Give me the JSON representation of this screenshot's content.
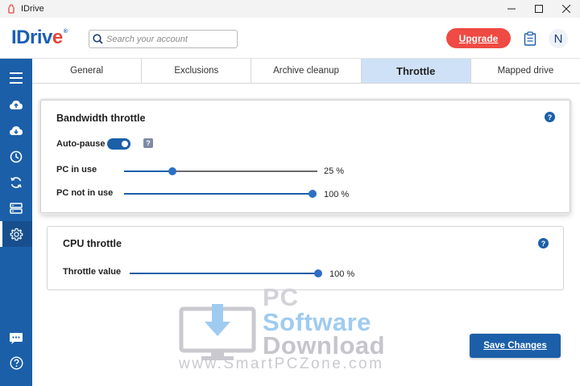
{
  "window": {
    "title": "IDrive",
    "controls": [
      "minimize-icon",
      "maximize-icon",
      "close-icon"
    ]
  },
  "header": {
    "logo_text": "IDriv",
    "logo_accent": "e",
    "search_placeholder": "Search your account",
    "upgrade_label": "Upgrade",
    "avatar_initial": "N"
  },
  "sidebar": {
    "items": [
      {
        "icon": "menu-icon"
      },
      {
        "icon": "cloud-upload-icon"
      },
      {
        "icon": "cloud-download-icon"
      },
      {
        "icon": "history-icon"
      },
      {
        "icon": "sync-icon"
      },
      {
        "icon": "server-icon"
      },
      {
        "icon": "gear-icon",
        "active": true
      },
      {
        "icon": "chat-icon"
      },
      {
        "icon": "help-icon"
      }
    ]
  },
  "tabs": [
    {
      "label": "General"
    },
    {
      "label": "Exclusions"
    },
    {
      "label": "Archive cleanup"
    },
    {
      "label": "Throttle",
      "active": true
    },
    {
      "label": "Mapped drive"
    }
  ],
  "bandwidth": {
    "title": "Bandwidth throttle",
    "auto_pause_label": "Auto-pause",
    "auto_pause_on": true,
    "pc_in_use_label": "PC in use",
    "pc_in_use_value": "25 %",
    "pc_in_use_level": 25,
    "pc_not_in_use_label": "PC not in use",
    "pc_not_in_use_value": "100 %",
    "pc_not_in_use_level": 100
  },
  "cpu": {
    "title": "CPU throttle",
    "throttle_label": "Throttle value",
    "throttle_value": "100 %",
    "throttle_level": 100
  },
  "watermark": {
    "line1": "PC",
    "line2": "Software",
    "line3": "Download",
    "url": "www.SmartPCZone.com"
  },
  "save_label": "Save Changes",
  "colors": {
    "accent": "#1b5fa9",
    "upgrade": "#ef4a43",
    "active_tab": "#cfe1f7"
  }
}
